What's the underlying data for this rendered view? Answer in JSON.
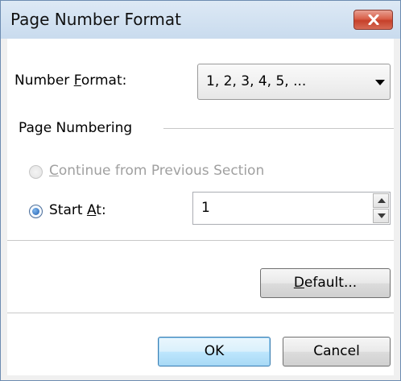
{
  "window": {
    "title": "Page Number Format"
  },
  "number_format": {
    "label_pre": "Number ",
    "label_key": "F",
    "label_post": "ormat:",
    "selected": "1, 2, 3, 4, 5, ..."
  },
  "page_numbering": {
    "group_label": "Page Numbering",
    "continue_option": {
      "key": "C",
      "label_post": "ontinue from Previous Section",
      "enabled": false,
      "selected": false
    },
    "start_option": {
      "label_pre": "Start ",
      "key": "A",
      "label_post": "t:",
      "selected": true,
      "value": "1"
    }
  },
  "buttons": {
    "default_key": "D",
    "default_post": "efault...",
    "ok": "OK",
    "cancel": "Cancel"
  },
  "colors": {
    "titlebar": "#c9dbee",
    "close_button": "#c6402a",
    "disabled_text": "#a0a0a0"
  }
}
